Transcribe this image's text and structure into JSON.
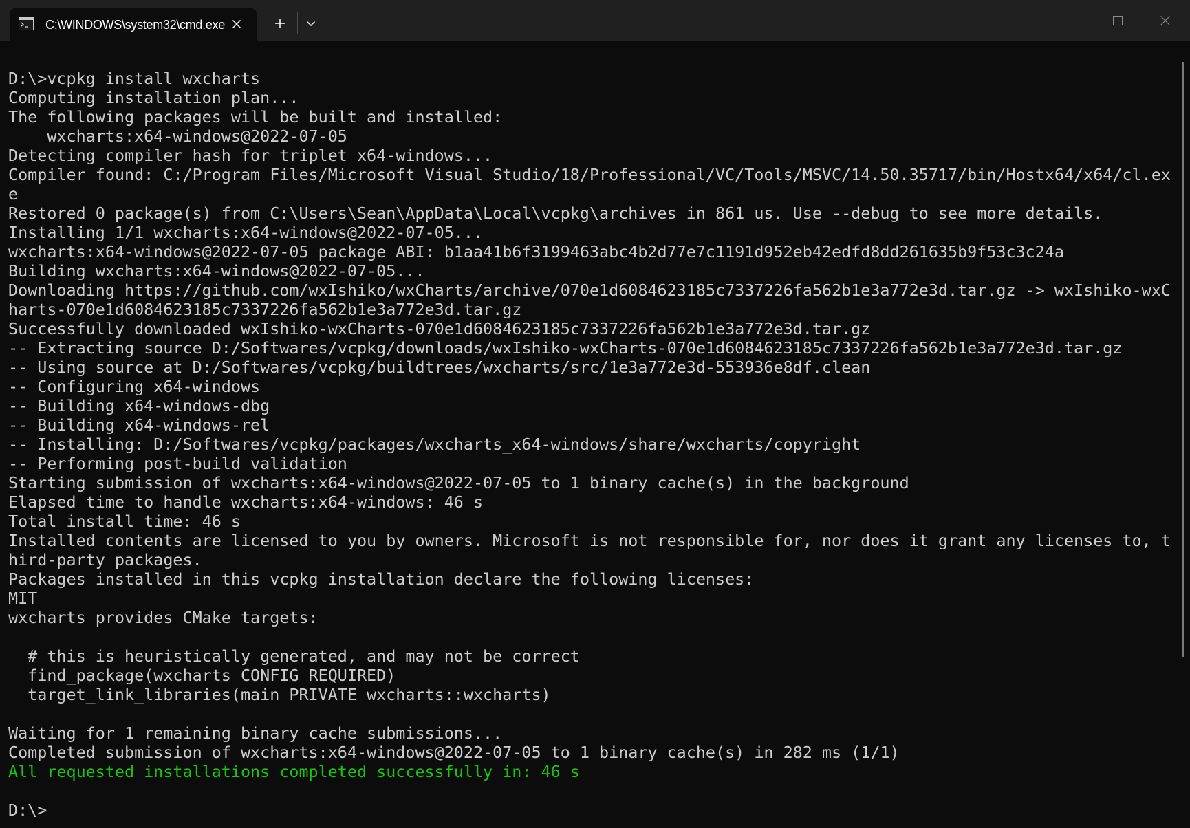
{
  "window": {
    "tab_title": "C:\\WINDOWS\\system32\\cmd.exe",
    "tab_icon": "terminal-icon",
    "close_tab_icon": "close-icon",
    "new_tab_icon": "plus-icon",
    "dropdown_icon": "chevron-down-icon",
    "controls": {
      "minimize_icon": "minimize-icon",
      "maximize_icon": "maximize-icon",
      "close_icon": "close-icon"
    }
  },
  "colors": {
    "background": "#0c0c0c",
    "titlebar": "#202020",
    "text": "#cccccc",
    "success": "#16c60c"
  },
  "terminal": {
    "lines": [
      "D:\\>vcpkg install wxcharts",
      "Computing installation plan...",
      "The following packages will be built and installed:",
      "    wxcharts:x64-windows@2022-07-05",
      "Detecting compiler hash for triplet x64-windows...",
      "Compiler found: C:/Program Files/Microsoft Visual Studio/18/Professional/VC/Tools/MSVC/14.50.35717/bin/Hostx64/x64/cl.ex",
      "e",
      "Restored 0 package(s) from C:\\Users\\Sean\\AppData\\Local\\vcpkg\\archives in 861 us. Use --debug to see more details.",
      "Installing 1/1 wxcharts:x64-windows@2022-07-05...",
      "wxcharts:x64-windows@2022-07-05 package ABI: b1aa41b6f3199463abc4b2d77e7c1191d952eb42edfd8dd261635b9f53c3c24a",
      "Building wxcharts:x64-windows@2022-07-05...",
      "Downloading https://github.com/wxIshiko/wxCharts/archive/070e1d6084623185c7337226fa562b1e3a772e3d.tar.gz -> wxIshiko-wxC",
      "harts-070e1d6084623185c7337226fa562b1e3a772e3d.tar.gz",
      "Successfully downloaded wxIshiko-wxCharts-070e1d6084623185c7337226fa562b1e3a772e3d.tar.gz",
      "-- Extracting source D:/Softwares/vcpkg/downloads/wxIshiko-wxCharts-070e1d6084623185c7337226fa562b1e3a772e3d.tar.gz",
      "-- Using source at D:/Softwares/vcpkg/buildtrees/wxcharts/src/1e3a772e3d-553936e8df.clean",
      "-- Configuring x64-windows",
      "-- Building x64-windows-dbg",
      "-- Building x64-windows-rel",
      "-- Installing: D:/Softwares/vcpkg/packages/wxcharts_x64-windows/share/wxcharts/copyright",
      "-- Performing post-build validation",
      "Starting submission of wxcharts:x64-windows@2022-07-05 to 1 binary cache(s) in the background",
      "Elapsed time to handle wxcharts:x64-windows: 46 s",
      "Total install time: 46 s",
      "Installed contents are licensed to you by owners. Microsoft is not responsible for, nor does it grant any licenses to, t",
      "hird-party packages.",
      "Packages installed in this vcpkg installation declare the following licenses:",
      "MIT",
      "wxcharts provides CMake targets:",
      "",
      "  # this is heuristically generated, and may not be correct",
      "  find_package(wxcharts CONFIG REQUIRED)",
      "  target_link_libraries(main PRIVATE wxcharts::wxcharts)",
      "",
      "Waiting for 1 remaining binary cache submissions...",
      "Completed submission of wxcharts:x64-windows@2022-07-05 to 1 binary cache(s) in 282 ms (1/1)",
      "All requested installations completed successfully in: 46 s",
      "",
      "D:\\>"
    ]
  }
}
